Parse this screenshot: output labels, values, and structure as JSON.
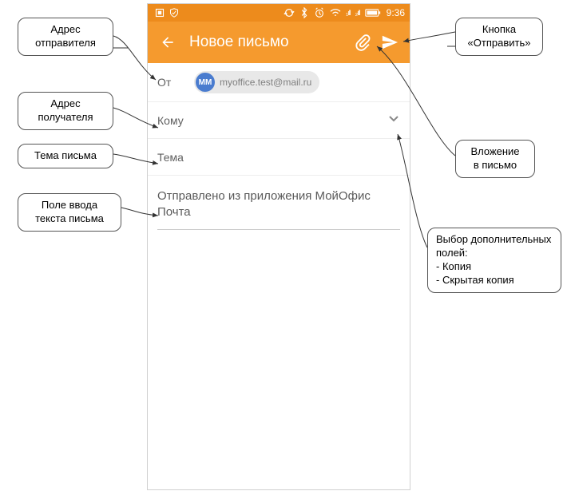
{
  "statusbar": {
    "time": "9:36"
  },
  "appbar": {
    "title": "Новое письмо"
  },
  "from": {
    "label": "От",
    "avatar": "ММ",
    "email": "myoffice.test@mail.ru"
  },
  "to": {
    "label": "Кому"
  },
  "subject": {
    "label": "Тема"
  },
  "body": {
    "text": "Отправлено из приложения МойОфис Почта"
  },
  "callouts": {
    "sender": "Адрес\nотправителя",
    "recipient": "Адрес\nполучателя",
    "subject": "Тема письма",
    "body": "Поле ввода\nтекста письма",
    "send": "Кнопка\n«Отправить»",
    "attach": "Вложение\nв письмо",
    "expand": "Выбор дополнительных\nполей:\n- Копия\n- Скрытая копия"
  }
}
